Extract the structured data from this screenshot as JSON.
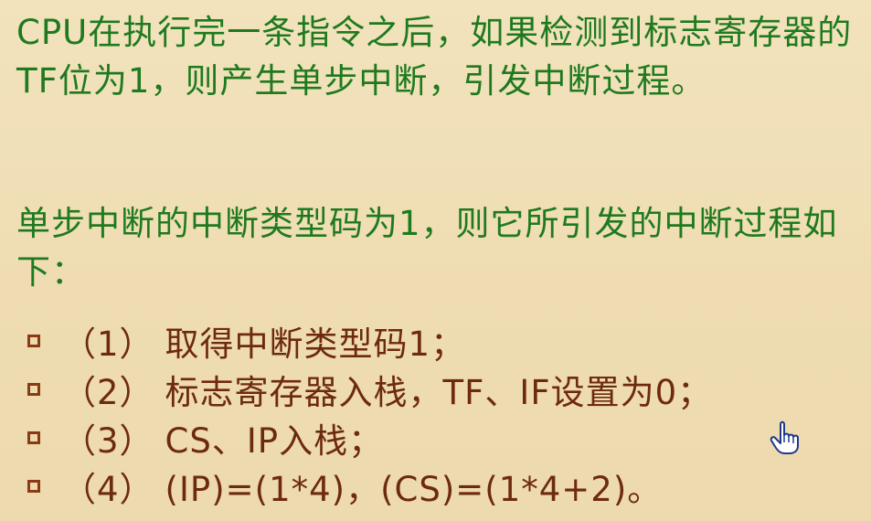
{
  "paragraph1": "CPU在执行完一条指令之后，如果检测到标志寄存器的TF位为1，则产生单步中断，引发中断过程。",
  "paragraph2": "单步中断的中断类型码为1，则它所引发的中断过程如下：",
  "steps": [
    {
      "num": "（1）",
      "text": "取得中断类型码1；"
    },
    {
      "num": "（2）",
      "text": "标志寄存器入栈，TF、IF设置为0；"
    },
    {
      "num": "（3）",
      "text": "CS、IP入栈；"
    },
    {
      "num": "（4）",
      "text": "(IP)=(1*4)，(CS)=(1*4+2)。"
    }
  ],
  "colors": {
    "paragraph": "#1f7a1f",
    "steps": "#6e2a10",
    "background": "#efdcb2"
  },
  "icons": {
    "cursor": "hand-pointer-icon",
    "bullet": "square-bullet-icon"
  }
}
